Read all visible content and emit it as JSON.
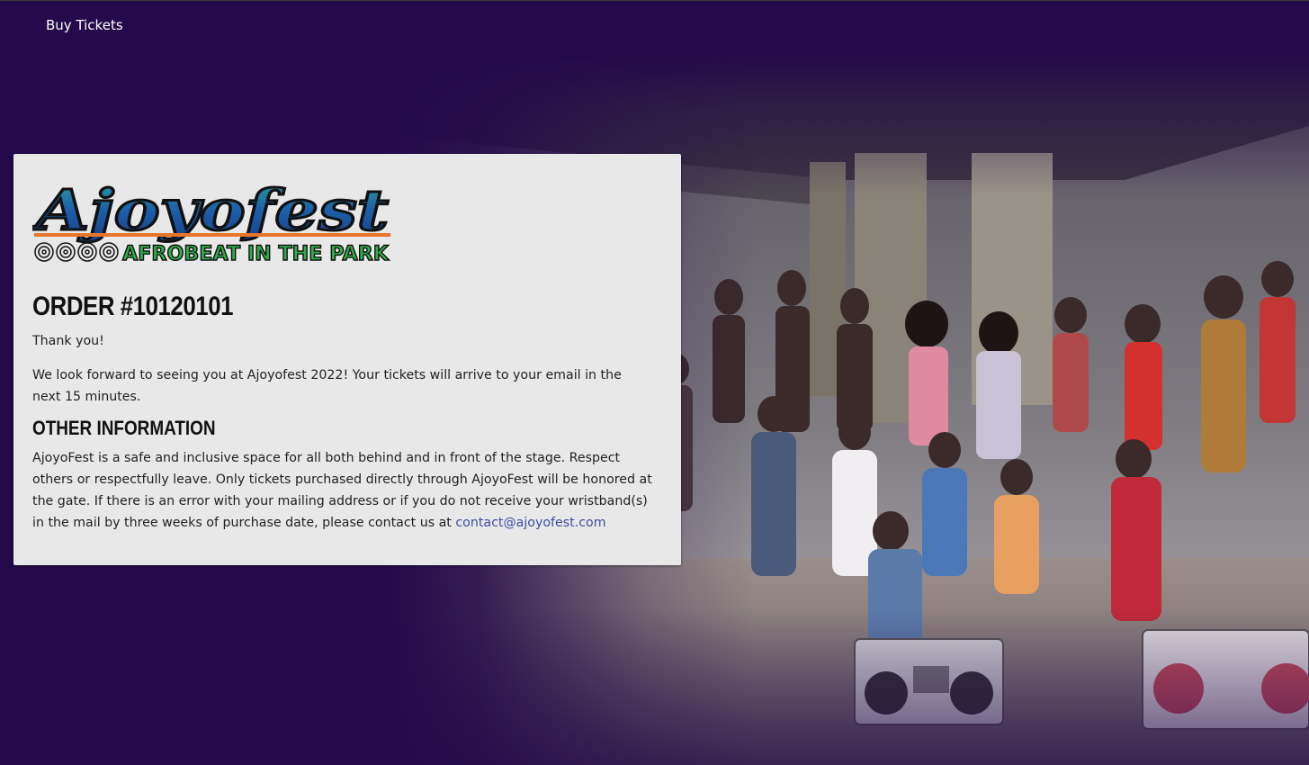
{
  "nav": {
    "buy_tickets": "Buy Tickets"
  },
  "logo": {
    "name": "Ajoyofest",
    "tagline": "AFROBEAT IN THE PARK"
  },
  "order": {
    "title": "ORDER #10120101",
    "thanks": "Thank you!",
    "message": "We look forward to seeing you at Ajoyofest 2022! Your tickets will arrive to your email in the next 15 minutes."
  },
  "other_info": {
    "heading": "OTHER INFORMATION",
    "text": "AjoyoFest is a safe and inclusive space for all both behind and in front of the stage. Respect others or respectfully leave. Only tickets purchased directly through AjoyoFest will be honored at the gate. If there is an error with your mailing address or if you do not receive your wristband(s) in the mail by three weeks of purchase date, please contact us at ",
    "email": "contact@ajoyofest.com"
  },
  "colors": {
    "background": "#240a4a",
    "card": "#e8e8e9",
    "link": "#3c4fa0",
    "logo_blue": "#1c5fa8",
    "logo_green": "#2fae4a",
    "logo_orange": "#e8762a"
  }
}
